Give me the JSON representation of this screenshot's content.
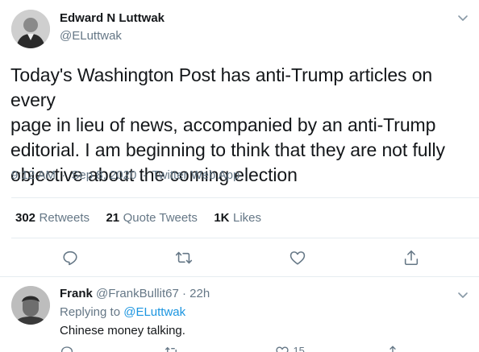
{
  "tweet": {
    "author_name": "Edward N Luttwak",
    "author_handle": "@ELuttwak",
    "text_lines": [
      "Today's Washington Post has anti-Trump articles on every",
      "page in lieu of news, accompanied by an anti-Trump",
      "editorial.  I am beginning to think that they are not fully",
      "objective about the coming election"
    ],
    "time": "9:12 AM",
    "date": "Sep 8, 2020",
    "source": "Twitter Web App",
    "sep": "·",
    "stats": {
      "retweets_count": "302",
      "retweets_label": "Retweets",
      "quotes_count": "21",
      "quotes_label": "Quote Tweets",
      "likes_count": "1K",
      "likes_label": "Likes"
    }
  },
  "reply": {
    "author_name": "Frank",
    "author_handle": "@FrankBullit67",
    "sep": "·",
    "age": "22h",
    "replying_prefix": "Replying to",
    "replying_to": "@ELuttwak",
    "text": "Chinese money talking.",
    "like_count": "15"
  },
  "icons": {
    "reply": "reply-icon",
    "retweet": "retweet-icon",
    "like": "heart-icon",
    "share": "share-icon",
    "caret": "chevron-down-icon"
  },
  "colors": {
    "text": "#14171a",
    "secondary": "#657786",
    "link": "#1b95e0",
    "divider": "#e6ecf0"
  }
}
